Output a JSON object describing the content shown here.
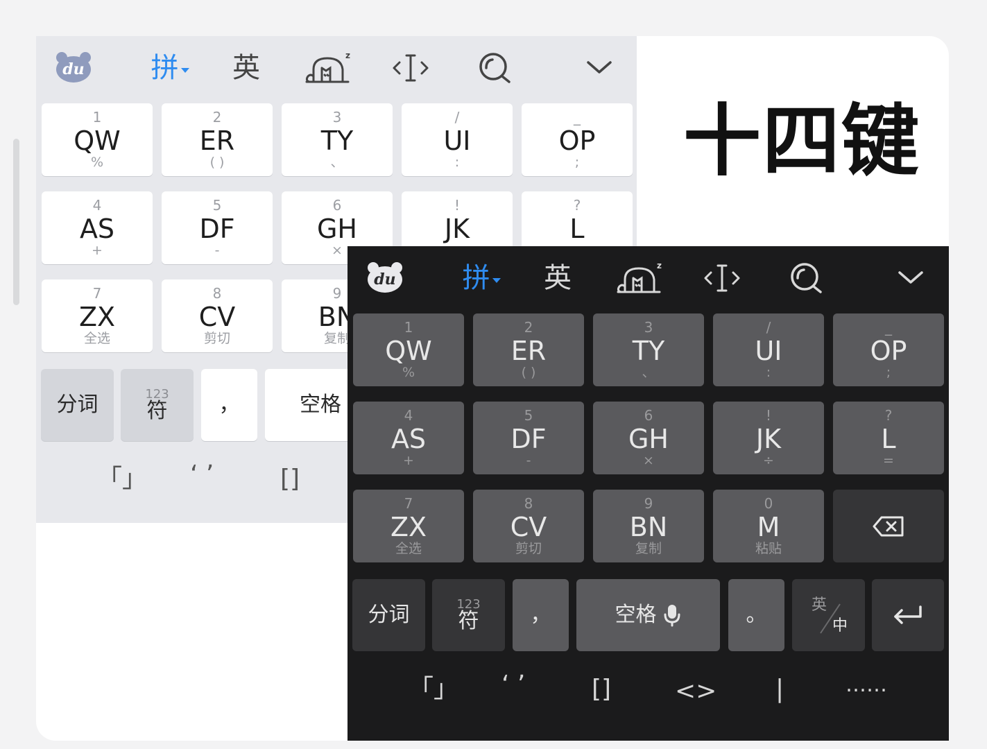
{
  "title": "十四键",
  "toolbar": {
    "logo_text": "du",
    "pinyin": "拼",
    "english": "英"
  },
  "rows": [
    [
      {
        "top": "1",
        "main": "QW",
        "sub": "%"
      },
      {
        "top": "2",
        "main": "ER",
        "sub": "( )"
      },
      {
        "top": "3",
        "main": "TY",
        "sub": "、"
      },
      {
        "top": "/",
        "main": "UI",
        "sub": ":"
      },
      {
        "top": "_",
        "main": "OP",
        "sub": ";"
      }
    ],
    [
      {
        "top": "4",
        "main": "AS",
        "sub": "+"
      },
      {
        "top": "5",
        "main": "DF",
        "sub": "-"
      },
      {
        "top": "6",
        "main": "GH",
        "sub": "×"
      },
      {
        "top": "!",
        "main": "JK",
        "sub": "÷"
      },
      {
        "top": "?",
        "main": "L",
        "sub": "="
      }
    ],
    [
      {
        "top": "7",
        "main": "ZX",
        "sub": "全选"
      },
      {
        "top": "8",
        "main": "CV",
        "sub": "剪切"
      },
      {
        "top": "9",
        "main": "BN",
        "sub": "复制"
      },
      {
        "top": "0",
        "main": "M",
        "sub": "粘贴"
      }
    ]
  ],
  "bottom_row": {
    "segment": "分词",
    "symbols_top": "123",
    "symbols": "符",
    "comma": "，",
    "space": "空格",
    "period": "。",
    "lang_top": "英",
    "lang_bottom": "中"
  },
  "symbol_bar": [
    "「」",
    "‘ ’",
    "[]",
    "<>",
    "|",
    "……"
  ]
}
